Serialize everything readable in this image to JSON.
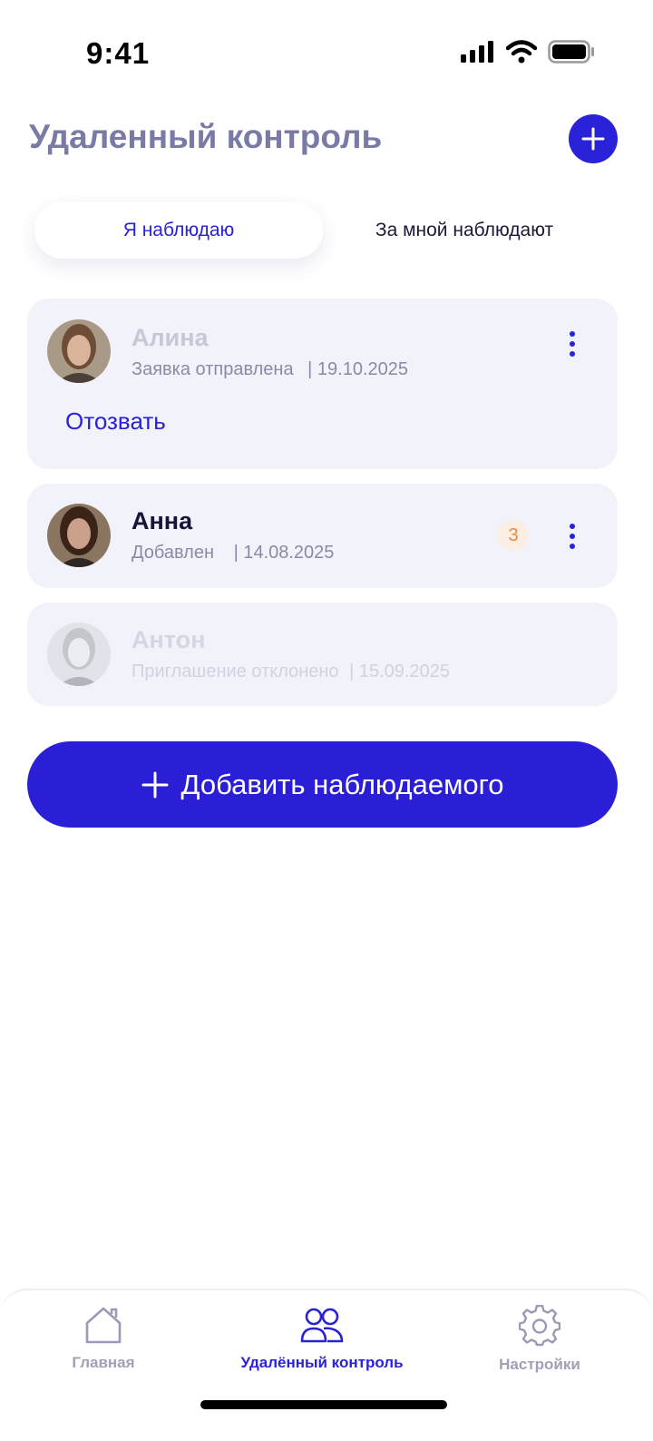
{
  "status": {
    "time": "9:41"
  },
  "header": {
    "title": "Удаленный контроль",
    "add_icon": "plus-icon"
  },
  "tabs": [
    {
      "label": "Я наблюдаю",
      "active": true
    },
    {
      "label": "За мной наблюдают",
      "active": false
    }
  ],
  "contacts": [
    {
      "name": "Алина",
      "status": "Заявка отправлена",
      "date": "| 19.10.2025",
      "action": "Отозвать"
    },
    {
      "name": "Анна",
      "status": "Добавлен",
      "date": "| 14.08.2025",
      "badge": "3"
    },
    {
      "name": "Антон",
      "status": "Приглашение отклонено",
      "date": "| 15.09.2025"
    }
  ],
  "add_button": {
    "label": "Добавить наблюдаемого",
    "icon": "plus-icon"
  },
  "nav": [
    {
      "label": "Главная",
      "icon": "home-icon",
      "active": false
    },
    {
      "label": "Удалённый контроль",
      "icon": "people-icon",
      "active": true
    },
    {
      "label": "Настройки",
      "icon": "gear-icon",
      "active": false
    }
  ],
  "colors": {
    "accent": "#2a22d8",
    "card_bg": "#f2f2fa",
    "badge_text": "#f08a3c",
    "title": "#7a7aa6"
  }
}
